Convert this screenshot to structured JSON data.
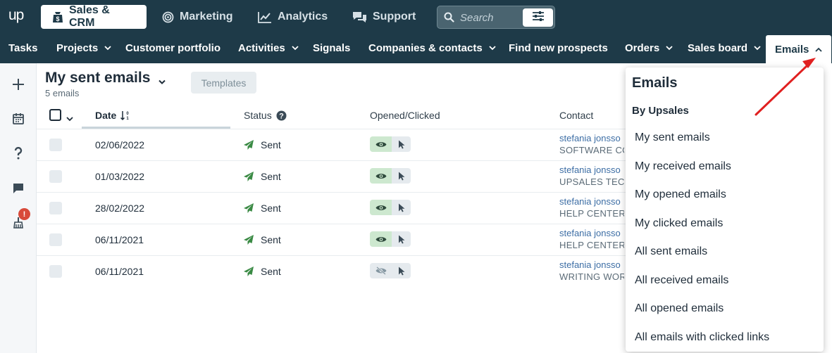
{
  "logo": "up",
  "app_tabs": [
    {
      "label": "Sales & CRM",
      "icon": "bag-dollar-icon"
    },
    {
      "label": "Marketing",
      "icon": "target-icon"
    },
    {
      "label": "Analytics",
      "icon": "line-chart-icon"
    },
    {
      "label": "Support",
      "icon": "chat-bubbles-icon"
    }
  ],
  "search": {
    "placeholder": "Search"
  },
  "subnav": [
    {
      "label": "Tasks"
    },
    {
      "label": "Projects"
    },
    {
      "label": "Customer portfolio"
    },
    {
      "label": "Activities"
    },
    {
      "label": "Signals"
    },
    {
      "label": "Companies & contacts"
    },
    {
      "label": "Find new prospects"
    },
    {
      "label": "Orders"
    },
    {
      "label": "Sales board"
    },
    {
      "label": "Emails"
    }
  ],
  "rail": {
    "badge": "!"
  },
  "header": {
    "title": "My sent emails",
    "count": "5 emails",
    "templates_label": "Templates"
  },
  "table": {
    "columns": {
      "date": "Date",
      "status": "Status",
      "opened": "Opened/Clicked",
      "contact": "Contact"
    },
    "rows": [
      {
        "date": "02/06/2022",
        "status": "Sent",
        "opened": true,
        "contact": "stefania jonsso",
        "company": "SOFTWARE CO"
      },
      {
        "date": "01/03/2022",
        "status": "Sent",
        "opened": true,
        "contact": "stefania jonsso",
        "company": "UPSALES TECH"
      },
      {
        "date": "28/02/2022",
        "status": "Sent",
        "opened": true,
        "contact": "stefania jonsso",
        "company": "HELP CENTER"
      },
      {
        "date": "06/11/2021",
        "status": "Sent",
        "opened": true,
        "contact": "stefania jonsso",
        "company": "HELP CENTER"
      },
      {
        "date": "06/11/2021",
        "status": "Sent",
        "opened": false,
        "contact": "stefania jonsso",
        "company": "WRITING WOR"
      }
    ]
  },
  "dropdown": {
    "title": "Emails",
    "section": "By Upsales",
    "items": [
      "My sent emails",
      "My received emails",
      "My opened emails",
      "My clicked emails",
      "All sent emails",
      "All received emails",
      "All opened emails",
      "All emails with clicked links"
    ]
  },
  "colors": {
    "topbar": "#1e3a48",
    "accent_green": "#3a8a44",
    "link_blue": "#3d6ea5",
    "arrow_red": "#e02020"
  }
}
